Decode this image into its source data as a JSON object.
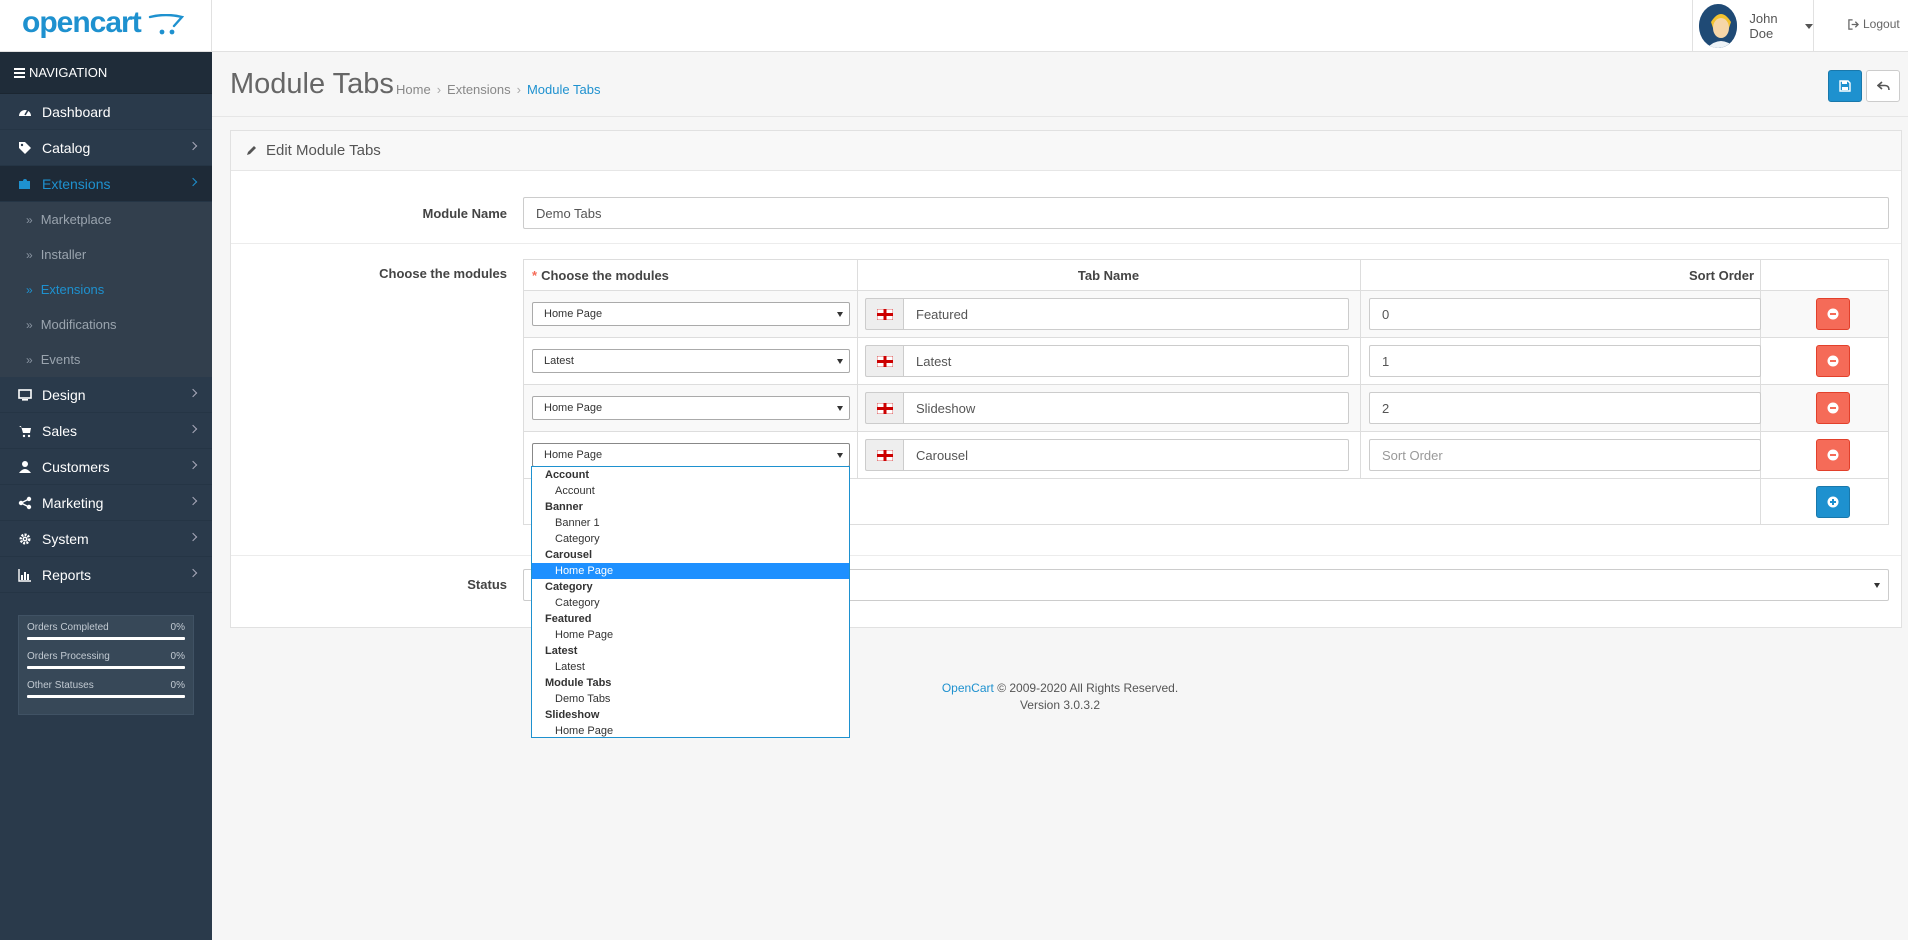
{
  "header": {
    "logo_text": "opencart",
    "user_name": "John Doe",
    "logout_label": "Logout"
  },
  "sidebar": {
    "nav_title": "NAVIGATION",
    "items": [
      {
        "label": "Dashboard",
        "icon": "dashboard-icon"
      },
      {
        "label": "Catalog",
        "icon": "tags-icon"
      },
      {
        "label": "Extensions",
        "icon": "puzzle-icon"
      },
      {
        "label": "Design",
        "icon": "monitor-icon"
      },
      {
        "label": "Sales",
        "icon": "cart-icon"
      },
      {
        "label": "Customers",
        "icon": "user-icon"
      },
      {
        "label": "Marketing",
        "icon": "share-icon"
      },
      {
        "label": "System",
        "icon": "gear-icon"
      },
      {
        "label": "Reports",
        "icon": "bar-chart-icon"
      }
    ],
    "extensions_sub": [
      "Marketplace",
      "Installer",
      "Extensions",
      "Modifications",
      "Events"
    ],
    "stats": [
      {
        "label": "Orders Completed",
        "value": "0%"
      },
      {
        "label": "Orders Processing",
        "value": "0%"
      },
      {
        "label": "Other Statuses",
        "value": "0%"
      }
    ]
  },
  "page": {
    "title": "Module Tabs",
    "breadcrumb": [
      "Home",
      "Extensions",
      "Module Tabs"
    ],
    "panel_title": "Edit Module Tabs",
    "module_name_label": "Module Name",
    "module_name_value": "Demo Tabs",
    "choose_label": "Choose the modules",
    "status_label": "Status"
  },
  "table": {
    "headers": {
      "required_mark": "*",
      "modules": "Choose the modules",
      "tab_name": "Tab Name",
      "sort_order": "Sort Order"
    },
    "rows": [
      {
        "module": "Home Page",
        "tab_name": "Featured",
        "sort_order": "0"
      },
      {
        "module": "Latest",
        "tab_name": "Latest",
        "sort_order": "1"
      },
      {
        "module": "Home Page",
        "tab_name": "Slideshow",
        "sort_order": "2"
      },
      {
        "module": "Home Page",
        "tab_name": "Carousel",
        "sort_order": ""
      }
    ],
    "sort_placeholder": "Sort Order"
  },
  "dropdown": {
    "groups": [
      {
        "label": "Account",
        "options": [
          "Account"
        ]
      },
      {
        "label": "Banner",
        "options": [
          "Banner 1",
          "Category"
        ]
      },
      {
        "label": "Carousel",
        "options": [
          "Home Page"
        ]
      },
      {
        "label": "Category",
        "options": [
          "Category"
        ]
      },
      {
        "label": "Featured",
        "options": [
          "Home Page"
        ]
      },
      {
        "label": "Latest",
        "options": [
          "Latest"
        ]
      },
      {
        "label": "Module Tabs",
        "options": [
          "Demo Tabs"
        ]
      },
      {
        "label": "Slideshow",
        "options": [
          "Home Page"
        ]
      }
    ],
    "selected": "Carousel > Home Page"
  },
  "footer": {
    "link": "OpenCart",
    "copyright": "© 2009-2020 All Rights Reserved.",
    "version": "Version 3.0.3.2"
  },
  "colors": {
    "primary": "#1e91cf",
    "danger": "#f56b58",
    "sidebar": "#2a3a4b"
  }
}
